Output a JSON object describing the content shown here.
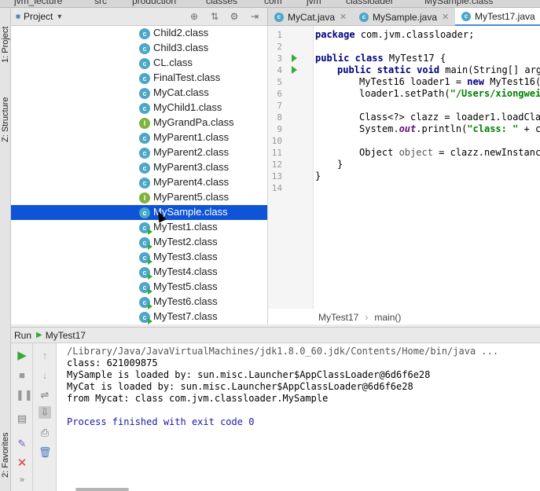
{
  "nav_strip": {
    "items": [
      "jvm_lecture",
      "src",
      "production",
      "classes",
      "com",
      "jvm",
      "classloader",
      "MySample.class"
    ]
  },
  "left_stripe": {
    "tabs": [
      "1: Project",
      "Z: Structure",
      "2: Favorites"
    ]
  },
  "project": {
    "title": "Project",
    "tree": [
      {
        "label": "Child2.class",
        "kind": "c",
        "runnable": false
      },
      {
        "label": "Child3.class",
        "kind": "c",
        "runnable": false
      },
      {
        "label": "CL.class",
        "kind": "c",
        "runnable": false
      },
      {
        "label": "FinalTest.class",
        "kind": "c",
        "runnable": false
      },
      {
        "label": "MyCat.class",
        "kind": "c",
        "runnable": false
      },
      {
        "label": "MyChild1.class",
        "kind": "c",
        "runnable": false
      },
      {
        "label": "MyGrandPa.class",
        "kind": "i",
        "runnable": false
      },
      {
        "label": "MyParent1.class",
        "kind": "c",
        "runnable": false
      },
      {
        "label": "MyParent2.class",
        "kind": "c",
        "runnable": false
      },
      {
        "label": "MyParent3.class",
        "kind": "c",
        "runnable": false
      },
      {
        "label": "MyParent4.class",
        "kind": "c",
        "runnable": false
      },
      {
        "label": "MyParent5.class",
        "kind": "i",
        "runnable": false
      },
      {
        "label": "MySample.class",
        "kind": "c",
        "runnable": false,
        "selected": true
      },
      {
        "label": "MyTest1.class",
        "kind": "c",
        "runnable": true
      },
      {
        "label": "MyTest2.class",
        "kind": "c",
        "runnable": true
      },
      {
        "label": "MyTest3.class",
        "kind": "c",
        "runnable": true
      },
      {
        "label": "MyTest4.class",
        "kind": "c",
        "runnable": true
      },
      {
        "label": "MyTest5.class",
        "kind": "c",
        "runnable": true
      },
      {
        "label": "MyTest6.class",
        "kind": "c",
        "runnable": true
      },
      {
        "label": "MyTest7.class",
        "kind": "c",
        "runnable": true
      }
    ]
  },
  "editor": {
    "tabs": [
      {
        "label": "MyCat.java",
        "active": false
      },
      {
        "label": "MySample.java",
        "active": false
      },
      {
        "label": "MyTest17.java",
        "active": true
      }
    ],
    "line_numbers": [
      "1",
      "2",
      "3",
      "4",
      "5",
      "6",
      "7",
      "8",
      "9",
      "10",
      "11",
      "12",
      "13",
      "14"
    ],
    "code": {
      "l1_kw": "package",
      "l1_rest": " com.jvm.classloader;",
      "l3_kw": "public class",
      "l3_rest": " MyTest17 {",
      "l4_kw": "public static void",
      "l4_rest": " main(String[] args",
      "l5_a": "MyTest16 loader1 = ",
      "l5_kw": "new",
      "l5_b": " MyTest16(",
      "l6_a": "loader1.setPath(",
      "l6_str": "\"/Users/xiongwei/",
      "l8_a": "Class<?> clazz = loader1.loadClas",
      "l9_a": "System.",
      "l9_fld": "out",
      "l9_b": ".println(",
      "l9_str": "\"class: \"",
      "l9_c": " + cl",
      "l11_a": "Object ",
      "l11_var": "object",
      "l11_b": " = clazz.newInstance",
      "l12": "}",
      "l13": "}"
    },
    "breadcrumb": {
      "class": "MyTest17",
      "sep": "›",
      "method": "main()"
    }
  },
  "run": {
    "label": "Run",
    "config": "MyTest17",
    "console": [
      "/Library/Java/JavaVirtualMachines/jdk1.8.0_60.jdk/Contents/Home/bin/java ...",
      "class: 621009875",
      "MySample is loaded by: sun.misc.Launcher$AppClassLoader@6d6f6e28",
      "MyCat is loaded by: sun.misc.Launcher$AppClassLoader@6d6f6e28",
      "from Mycat: class com.jvm.classloader.MySample",
      "",
      "Process finished with exit code 0"
    ]
  },
  "colors": {
    "selection": "#0f54d6",
    "keyword": "#000080",
    "string": "#008000",
    "run_green": "#3aa83a",
    "stop_red": "#d64040"
  }
}
